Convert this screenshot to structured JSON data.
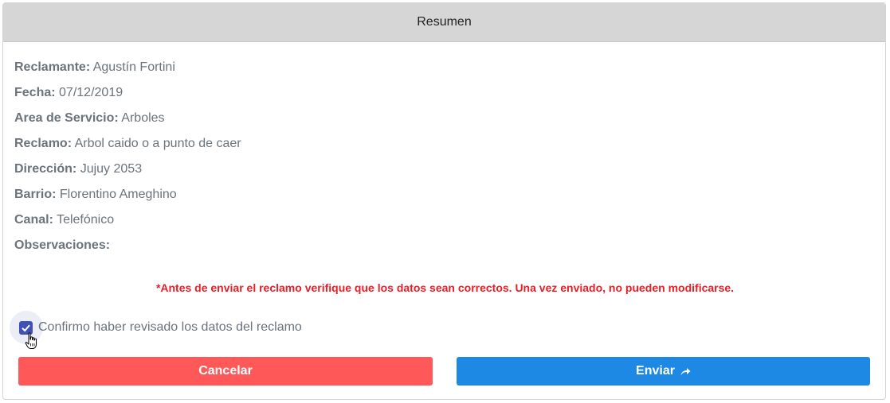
{
  "header": {
    "title": "Resumen"
  },
  "fields": [
    {
      "label": "Reclamante:",
      "value": "Agustín Fortini"
    },
    {
      "label": "Fecha:",
      "value": "07/12/2019"
    },
    {
      "label": "Area de Servicio:",
      "value": "Arboles"
    },
    {
      "label": "Reclamo:",
      "value": "Arbol caido o a punto de caer"
    },
    {
      "label": "Dirección:",
      "value": "Jujuy 2053"
    },
    {
      "label": "Barrio:",
      "value": "Florentino Ameghino"
    },
    {
      "label": "Canal:",
      "value": "Telefónico"
    },
    {
      "label": "Observaciones:",
      "value": ""
    }
  ],
  "warning": "*Antes de enviar el reclamo verifique que los datos sean correctos. Una vez enviado, no pueden modificarse.",
  "confirm": {
    "label": "Confirmo haber revisado los datos del reclamo",
    "checked": true
  },
  "buttons": {
    "cancel_label": "Cancelar",
    "send_label": "Enviar",
    "send_icon": "share-icon"
  },
  "colors": {
    "header_bg": "#d6d6d6",
    "cancel": "#ff5858",
    "send": "#1e88e5",
    "warning": "#ee1c25",
    "checkbox": "#3f51b5"
  }
}
